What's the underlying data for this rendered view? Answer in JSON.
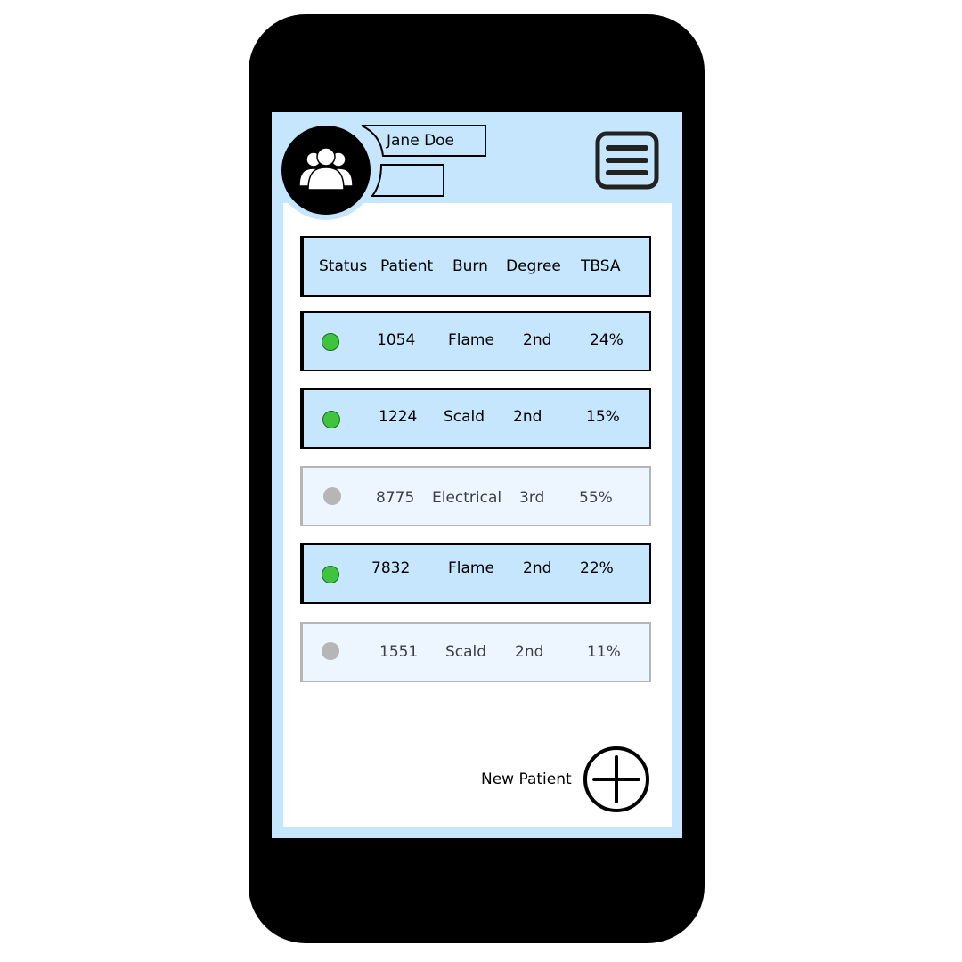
{
  "user": {
    "name": "Jane Doe",
    "secondary": ""
  },
  "table": {
    "headers": [
      "Status",
      "Patient",
      "Burn",
      "Degree",
      "TBSA"
    ],
    "rows": [
      {
        "status": "active",
        "patient": "1054",
        "burn": "Flame",
        "degree": "2nd",
        "tbsa": "24%"
      },
      {
        "status": "active",
        "patient": "1224",
        "burn": "Scald",
        "degree": "2nd",
        "tbsa": "15%"
      },
      {
        "status": "inactive",
        "patient": "8775",
        "burn": "Electrical",
        "degree": "3rd",
        "tbsa": "55%"
      },
      {
        "status": "active",
        "patient": "7832",
        "burn": "Flame",
        "degree": "2nd",
        "tbsa": "22%"
      },
      {
        "status": "inactive",
        "patient": "1551",
        "burn": "Scald",
        "degree": "2nd",
        "tbsa": "11%"
      }
    ]
  },
  "actions": {
    "new_patient_label": "New Patient"
  },
  "icons": {
    "avatar": "user-group-icon",
    "menu": "hamburger-menu-icon",
    "add": "plus-circle-icon"
  },
  "colors": {
    "screen_bg": "#c5e6fc",
    "inactive_row_bg": "#edf6fe",
    "status_active": "#3ec43e",
    "status_inactive": "#b6b6b6"
  }
}
